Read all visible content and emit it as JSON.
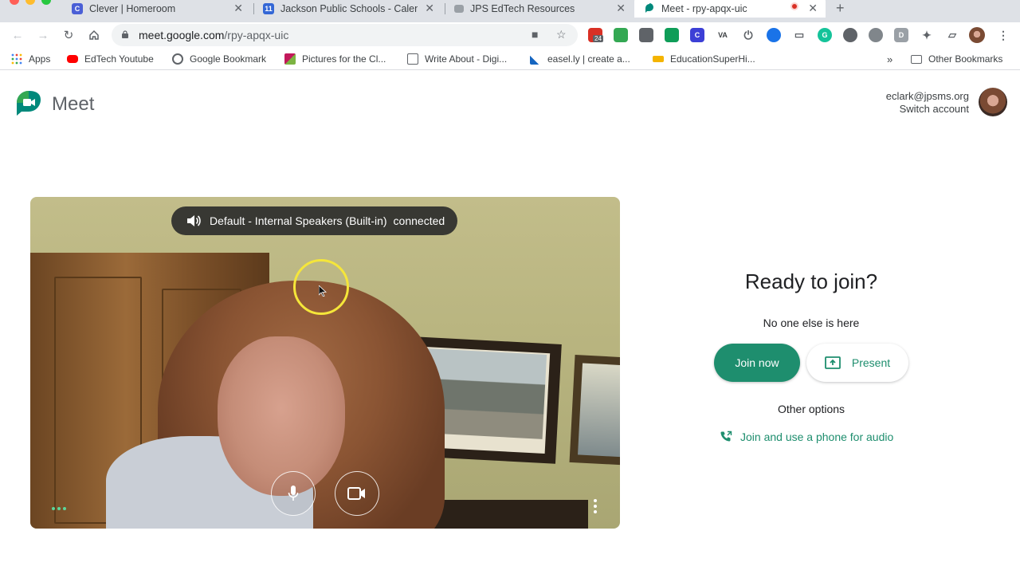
{
  "browser": {
    "tabs": [
      {
        "title": "Clever | Homeroom",
        "icon": "clever-icon"
      },
      {
        "title": "Jackson Public Schools - Calen",
        "icon": "calendar-icon"
      },
      {
        "title": "JPS EdTech Resources",
        "icon": "jps-icon"
      },
      {
        "title": "Meet - rpy-apqx-uic",
        "icon": "meet-icon",
        "active": true
      }
    ],
    "new_tab": "+",
    "url_host": "meet.google.com",
    "url_path": "/rpy-apqx-uic",
    "extension_badge": "24",
    "bookmarks": [
      {
        "label": "Apps",
        "icon": "apps-grid-icon"
      },
      {
        "label": "EdTech Youtube",
        "icon": "youtube-icon"
      },
      {
        "label": "Google Bookmark",
        "icon": "globe-icon"
      },
      {
        "label": "Pictures for the Cl...",
        "icon": "image-icon"
      },
      {
        "label": "Write About - Digi...",
        "icon": "page-icon"
      },
      {
        "label": "easel.ly | create a...",
        "icon": "easelly-icon"
      },
      {
        "label": "EducationSuperHi...",
        "icon": "superhighway-icon"
      }
    ],
    "bookmarks_overflow": "»",
    "other_bookmarks": "Other Bookmarks"
  },
  "meet": {
    "logo_text": "Meet",
    "account_email": "eclark@jpsms.org",
    "switch_account": "Switch account",
    "audio_device": "Default - Internal Speakers (Built-in)",
    "audio_status": "connected",
    "ready_title": "Ready to join?",
    "status_text": "No one else is here",
    "join_label": "Join now",
    "present_label": "Present",
    "other_options": "Other options",
    "phone_audio": "Join and use a phone for audio"
  },
  "colors": {
    "meet_green": "#1e8e6e",
    "chrome_tabstrip": "#dee1e6",
    "cursor_highlight": "#f5e63a"
  }
}
